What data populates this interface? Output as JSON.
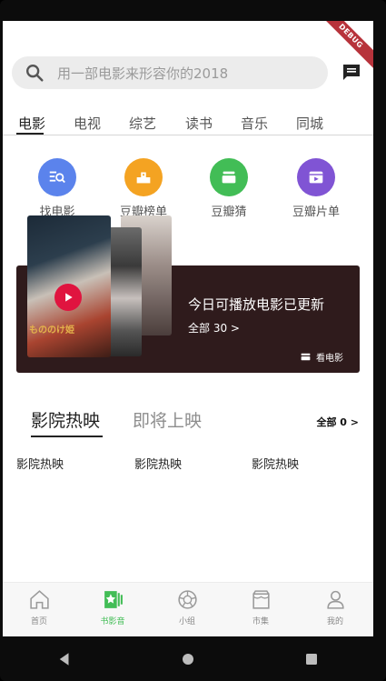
{
  "status": {
    "debug_banner": "DEBUG"
  },
  "search": {
    "placeholder": "用一部电影来形容你的2018"
  },
  "top_tabs": [
    "电影",
    "电视",
    "综艺",
    "读书",
    "音乐",
    "同城"
  ],
  "quick_entries": [
    {
      "label": "找电影",
      "color": "#5b83ec",
      "icon": "search-list-icon"
    },
    {
      "label": "豆瓣榜单",
      "color": "#f4a322",
      "icon": "podium-icon"
    },
    {
      "label": "豆瓣猜",
      "color": "#42bd56",
      "icon": "stack-icon"
    },
    {
      "label": "豆瓣片单",
      "color": "#8054d4",
      "icon": "film-list-icon"
    }
  ],
  "banner": {
    "title": "今日可播放电影已更新",
    "count_text": "全部 30 >",
    "action_label": "看电影",
    "poster_title": "もののけ姫"
  },
  "movie_tabs": {
    "active": "影院热映",
    "inactive": "即将上映",
    "all_link": "全部 0 >"
  },
  "movie_list": [
    "影院热映",
    "影院热映",
    "影院热映"
  ],
  "bottom_nav": [
    {
      "label": "首页",
      "icon": "home-icon",
      "active": false
    },
    {
      "label": "书影音",
      "icon": "bookmovie-icon",
      "active": true
    },
    {
      "label": "小组",
      "icon": "group-icon",
      "active": false
    },
    {
      "label": "市集",
      "icon": "market-icon",
      "active": false
    },
    {
      "label": "我的",
      "icon": "profile-icon",
      "active": false
    }
  ],
  "colors": {
    "accent": "#42bd56",
    "banner_bg": "#2f1b1c",
    "play": "#e0143f"
  }
}
